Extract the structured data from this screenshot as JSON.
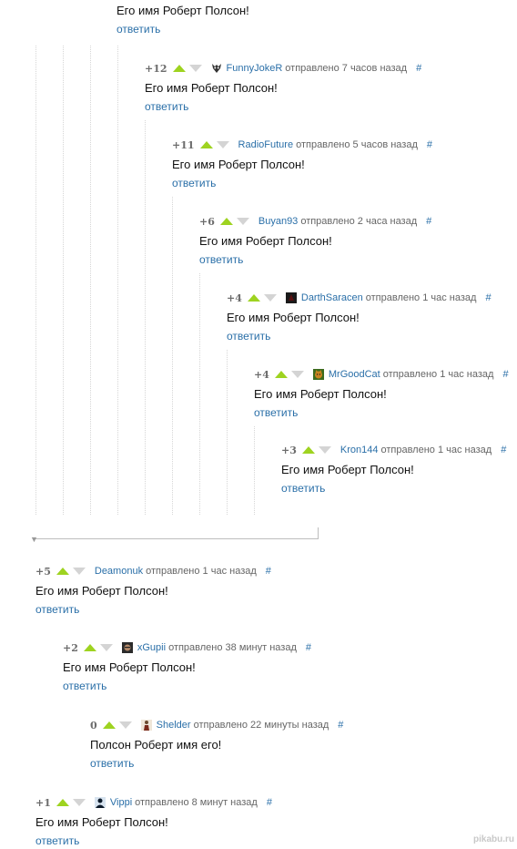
{
  "top": {
    "text": "Его имя Роберт Полсон!",
    "reply": "ответить"
  },
  "comments": [
    {
      "score": "+12",
      "user": "FunnyJokeR",
      "time": "отправлено 7 часов назад",
      "hash": "#",
      "text": "Его имя Роберт Полсон!",
      "reply": "ответить",
      "avatar": "mask-avatar"
    },
    {
      "score": "+11",
      "user": "RadioFuture",
      "time": "отправлено 5 часов назад",
      "hash": "#",
      "text": "Его имя Роберт Полсон!",
      "reply": "ответить",
      "avatar": ""
    },
    {
      "score": "+6",
      "user": "Buyan93",
      "time": "отправлено 2 часа назад",
      "hash": "#",
      "text": "Его имя Роберт Полсон!",
      "reply": "ответить",
      "avatar": ""
    },
    {
      "score": "+4",
      "user": "DarthSaracen",
      "time": "отправлено 1 час назад",
      "hash": "#",
      "text": "Его имя Роберт Полсон!",
      "reply": "ответить",
      "avatar": "dark-avatar"
    },
    {
      "score": "+4",
      "user": "MrGoodCat",
      "time": "отправлено 1 час назад",
      "hash": "#",
      "text": "Его имя Роберт Полсон!",
      "reply": "ответить",
      "avatar": "cat-avatar"
    },
    {
      "score": "+3",
      "user": "Kron144",
      "time": "отправлено 1 час назад",
      "hash": "#",
      "text": "Его имя Роберт Полсон!",
      "reply": "ответить",
      "avatar": ""
    },
    {
      "score": "+5",
      "user": "Deamonuk",
      "time": "отправлено 1 час назад",
      "hash": "#",
      "text": "Его имя Роберт Полсон!",
      "reply": "ответить",
      "avatar": ""
    },
    {
      "score": "+2",
      "user": "xGupii",
      "time": "отправлено 38 минут назад",
      "hash": "#",
      "text": "Его имя Роберт Полсон!",
      "reply": "ответить",
      "avatar": "face-avatar"
    },
    {
      "score": "0",
      "user": "Shelder",
      "time": "отправлено 22 минуты назад",
      "hash": "#",
      "text": "Полсон Роберт имя его!",
      "reply": "ответить",
      "avatar": "figure-avatar"
    },
    {
      "score": "+1",
      "user": "Vippi",
      "time": "отправлено 8 минут назад",
      "hash": "#",
      "text": "Его имя Роберт Полсон!",
      "reply": "ответить",
      "avatar": "silhouette-avatar"
    }
  ],
  "colors": {
    "link": "#2a6fa8",
    "upvote": "#9ed320",
    "downvote": "#d4d4d4",
    "text": "#111111",
    "meta": "#666666"
  },
  "watermark": "pikabu.ru"
}
